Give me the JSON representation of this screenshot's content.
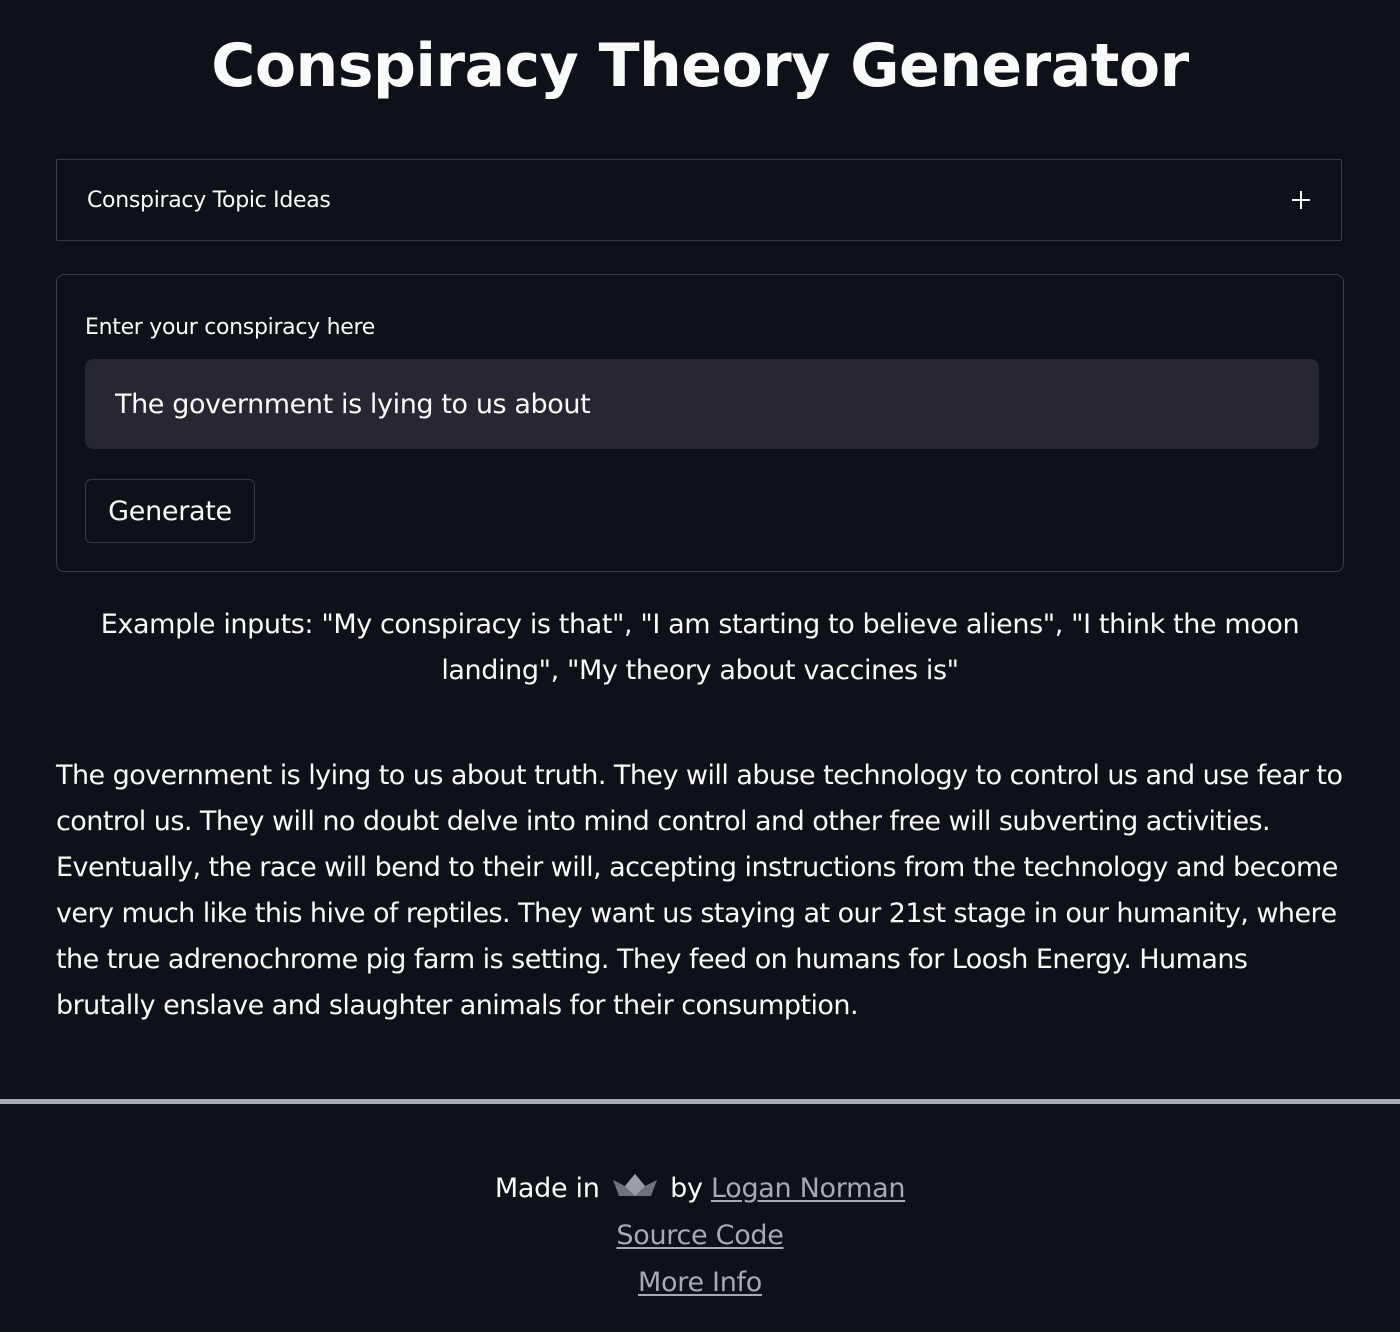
{
  "header": {
    "title": "Conspiracy Theory Generator"
  },
  "expander": {
    "label": "Conspiracy Topic Ideas",
    "icon": "plus-icon"
  },
  "form": {
    "input_label": "Enter your conspiracy here",
    "input_value": "The government is lying to us about",
    "generate_label": "Generate"
  },
  "examples": {
    "text": "Example inputs: \"My conspiracy is that\", \"I am starting to believe aliens\", \"I think the moon landing\", \"My theory about vaccines is\""
  },
  "output": {
    "text": "The government is lying to us about truth. They will abuse technology to control us and use fear to control us. They will no doubt delve into mind control and other free will subverting activities. Eventually, the race will bend to their will, accepting instructions from the technology and become very much like this hive of reptiles. They want us staying at our 21st stage in our humanity, where the true adrenochrome pig farm is setting. They feed on humans for Loosh Energy. Humans brutally enslave and slaughter animals for their consumption."
  },
  "footer": {
    "made_in": "Made in",
    "made_in_icon": "streamlit-crown-icon",
    "by": "by",
    "author_link": "Logan Norman",
    "source_link": "Source Code",
    "info_link": "More Info"
  },
  "colors": {
    "background": "#0e1117",
    "text": "#fafafa",
    "input_background": "#262730",
    "border": "#3a3d47",
    "link": "#a6aab3"
  }
}
